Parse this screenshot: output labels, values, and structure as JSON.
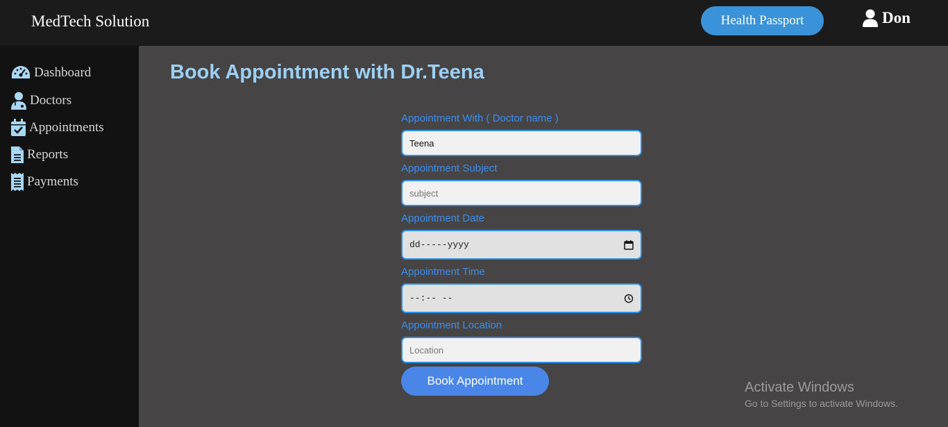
{
  "header": {
    "brand": "MedTech Solution",
    "passport_button": "Health Passport",
    "user_name": "Don"
  },
  "sidebar": {
    "items": [
      {
        "label": "Dashboard",
        "icon": "gauge-icon"
      },
      {
        "label": "Doctors",
        "icon": "doctor-icon"
      },
      {
        "label": "Appointments",
        "icon": "calendar-check-icon"
      },
      {
        "label": "Reports",
        "icon": "file-icon"
      },
      {
        "label": "Payments",
        "icon": "receipt-icon"
      }
    ]
  },
  "main": {
    "title": "Book Appointment with Dr.Teena",
    "form": {
      "doctor_label": "Appointment With ( Doctor name )",
      "doctor_value": "Teena",
      "subject_label": "Appointment Subject",
      "subject_placeholder": "subject",
      "date_label": "Appointment Date",
      "date_value": "dd-----yyyy",
      "time_label": "Appointment Time",
      "time_value": "--:-- --",
      "location_label": "Appointment Location",
      "location_placeholder": "Location",
      "submit_label": "Book Appointment"
    }
  },
  "watermark": {
    "title": "Activate Windows",
    "subtitle": "Go to Settings to activate Windows."
  },
  "colors": {
    "accent": "#3a93d8",
    "title": "#9dd0f5",
    "label": "#3a8ef0",
    "sidebar_icon": "#a9d8f7"
  }
}
